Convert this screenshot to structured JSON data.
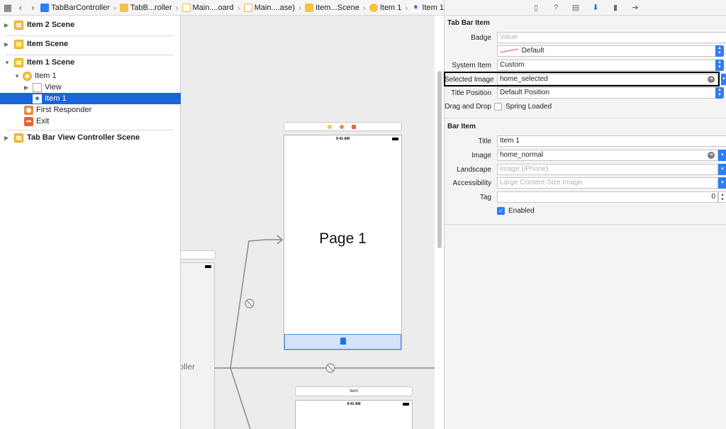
{
  "breadcrumb": {
    "items": [
      "TabBarController",
      "TabB...roller",
      "Main....oard",
      "Main....ase)",
      "Item...Scene",
      "Item 1",
      "Item 1"
    ]
  },
  "outline": {
    "scenes": [
      {
        "label": "Item 2 Scene"
      },
      {
        "label": "Item Scene"
      },
      {
        "label": "Item 1 Scene"
      },
      {
        "label": "Tab Bar View Controller Scene"
      }
    ],
    "tree": {
      "item": "Item 1",
      "view": "View",
      "tab_item": "Item 1",
      "first_responder": "First Responder",
      "exit": "Exit"
    }
  },
  "canvas": {
    "page_title": "Page 1",
    "status_time": "9:41 AM",
    "second_scene_title": "Item",
    "controller_label": "troller"
  },
  "inspector": {
    "tab_bar_item": {
      "section_title": "Tab Bar Item",
      "badge_label": "Badge",
      "badge_placeholder": "Value",
      "badge_color": "Default",
      "system_item_label": "System Item",
      "system_item_value": "Custom",
      "selected_image_label": "Selected Image",
      "selected_image_value": "home_selected",
      "title_position_label": "Title Position",
      "title_position_value": "Default Position",
      "drag_drop_label": "Drag and Drop",
      "spring_loaded_label": "Spring Loaded"
    },
    "bar_item": {
      "section_title": "Bar Item",
      "title_label": "Title",
      "title_value": "Item 1",
      "image_label": "Image",
      "image_value": "home_normal",
      "landscape_label": "Landscape",
      "landscape_placeholder": "Image (iPhone)",
      "accessibility_label": "Accessibility",
      "accessibility_placeholder": "Large Content Size Image",
      "tag_label": "Tag",
      "tag_value": "0",
      "enabled_label": "Enabled"
    }
  },
  "colors": {
    "selection": "#1a65d8",
    "accent": "#2f7cf6",
    "scene_icon": "#f6c342"
  }
}
